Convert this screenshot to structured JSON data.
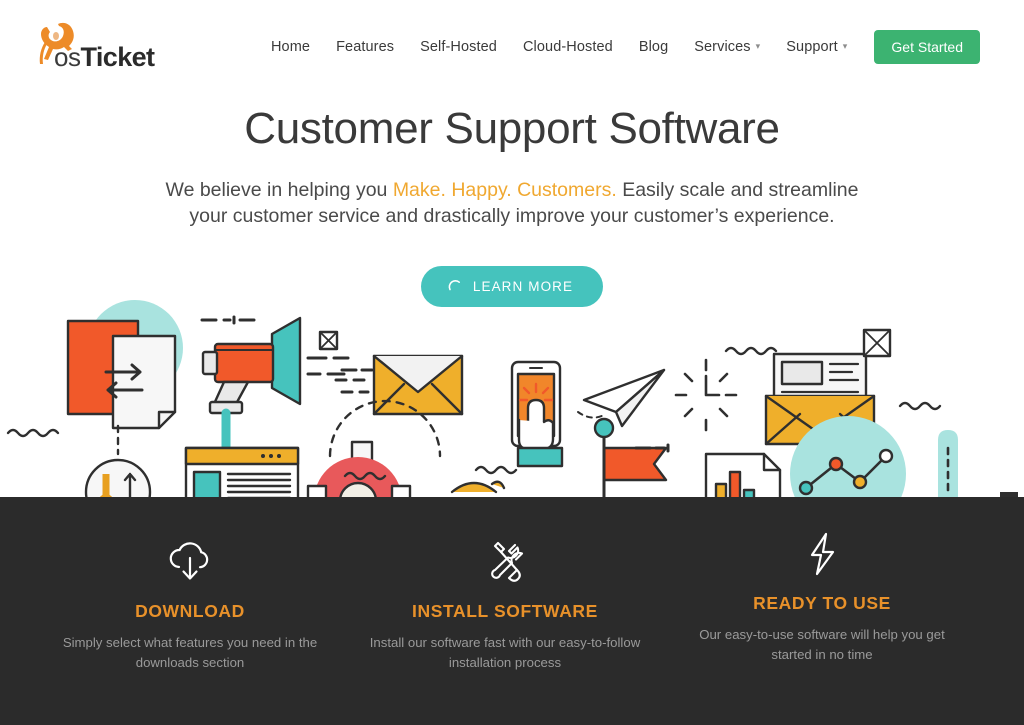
{
  "brand": {
    "name_light": "os",
    "name_bold": "Ticket",
    "logo_icon": "kangaroo-icon",
    "logo_color": "#ED8B28"
  },
  "nav": {
    "items": [
      {
        "label": "Home",
        "has_dropdown": false
      },
      {
        "label": "Features",
        "has_dropdown": false
      },
      {
        "label": "Self-Hosted",
        "has_dropdown": false
      },
      {
        "label": "Cloud-Hosted",
        "has_dropdown": false
      },
      {
        "label": "Blog",
        "has_dropdown": false
      },
      {
        "label": "Services",
        "has_dropdown": true
      },
      {
        "label": "Support",
        "has_dropdown": true
      }
    ],
    "cta": {
      "label": "Get Started",
      "color": "#3CB371"
    },
    "caret_glyph": "▾"
  },
  "hero": {
    "title": "Customer Support Software",
    "sub_before": "We believe in helping you ",
    "sub_highlight": "Make. Happy. Customers.",
    "sub_after": " Easily scale and streamline",
    "sub_line2": "your customer service and drastically improve your customer’s experience.",
    "highlight_color": "#F0A830",
    "cta": {
      "label": "LEARN MORE",
      "icon": "spinner-arc-icon",
      "color": "#45C3BD"
    }
  },
  "illustration": {
    "name": "customer-support-flat-illustration",
    "palette": {
      "teal": "#46C3BD",
      "teal_light": "#A9E3DF",
      "orange": "#F1592A",
      "yellow": "#EFAF2B",
      "red": "#E8595B",
      "dark": "#2F2F2F",
      "paper": "#F2F2F2"
    }
  },
  "features": {
    "background": "#2B2B2B",
    "title_color": "#E8912A",
    "items": [
      {
        "icon": "cloud-download-icon",
        "title": "DOWNLOAD",
        "desc": "Simply select what features you need in the downloads section"
      },
      {
        "icon": "wrench-screwdriver-icon",
        "title": "INSTALL SOFTWARE",
        "desc": "Install our software fast with our easy-to-follow installation process"
      },
      {
        "icon": "lightning-bolt-icon",
        "title": "READY TO USE",
        "desc": "Our easy-to-use software will help you get started in no time"
      }
    ]
  }
}
